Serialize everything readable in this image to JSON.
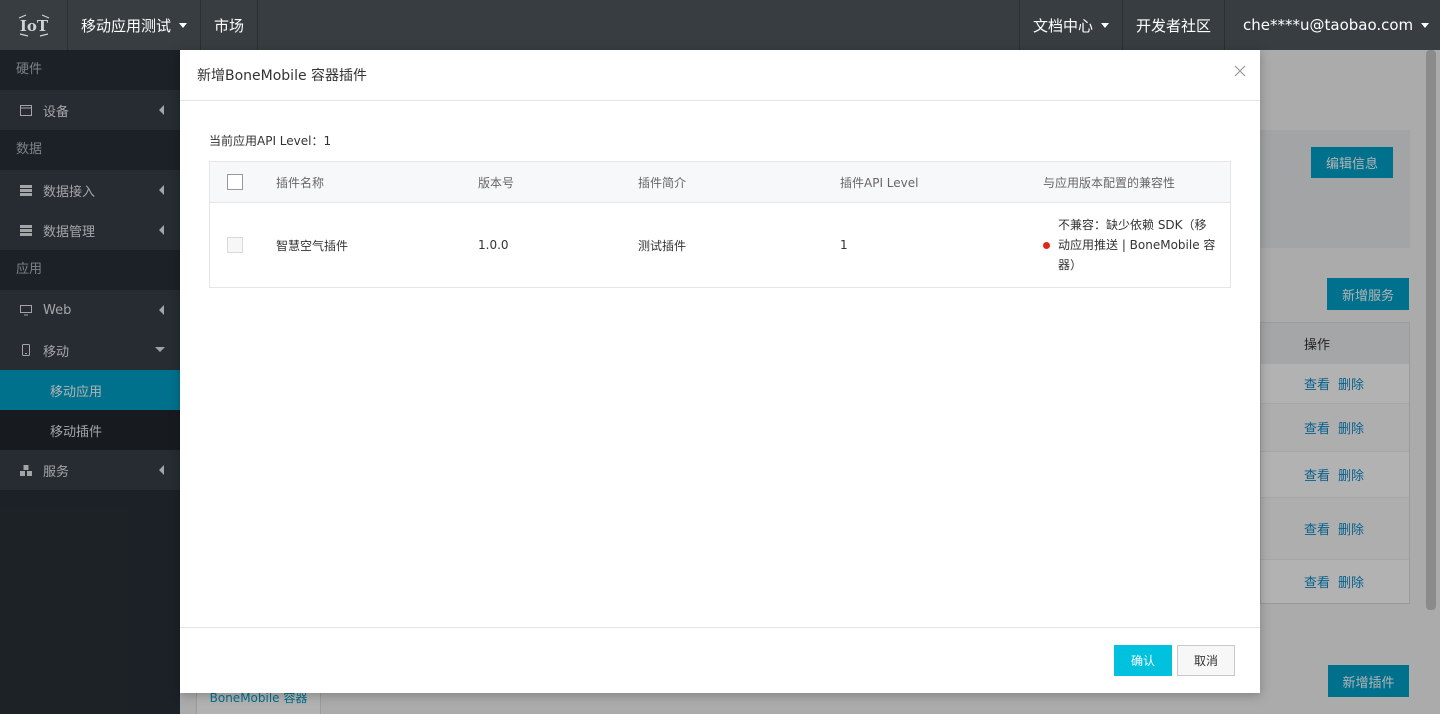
{
  "topbar": {
    "app_selector": "移动应用测试",
    "market": "市场",
    "docs": "文档中心",
    "community": "开发者社区",
    "user": "che****u@taobao.com"
  },
  "sidebar": {
    "group_hardware": "硬件",
    "item_device": "设备",
    "group_data": "数据",
    "item_data_access": "数据接入",
    "item_data_manage": "数据管理",
    "group_app": "应用",
    "item_web": "Web",
    "item_mobile": "移动",
    "sub_mobile_app": "移动应用",
    "sub_mobile_plugin": "移动插件",
    "item_service": "服务"
  },
  "background": {
    "edit_info": "编辑信息",
    "add_service": "新增服务",
    "col_action": "操作",
    "view": "查看",
    "delete": "删除",
    "add_plugin": "新增插件",
    "tab_bonemobile": "BoneMobile 容器"
  },
  "modal": {
    "title": "新增BoneMobile 容器插件",
    "api_level": "当前应用API Level：1",
    "columns": [
      "插件名称",
      "版本号",
      "插件简介",
      "插件API Level",
      "与应用版本配置的兼容性"
    ],
    "rows": [
      {
        "name": "智慧空气插件",
        "version": "1.0.0",
        "description": "测试插件",
        "api_level": "1",
        "compat": "不兼容：缺少依赖 SDK（移动应用推送 | BoneMobile 容器）",
        "compat_color": "#e0261b"
      }
    ],
    "ok": "确认",
    "cancel": "取消"
  },
  "colors": {
    "topbar": "#373d41",
    "sidebar": "#293038",
    "accent": "#00a2ca",
    "ok_button": "#00c1de"
  }
}
